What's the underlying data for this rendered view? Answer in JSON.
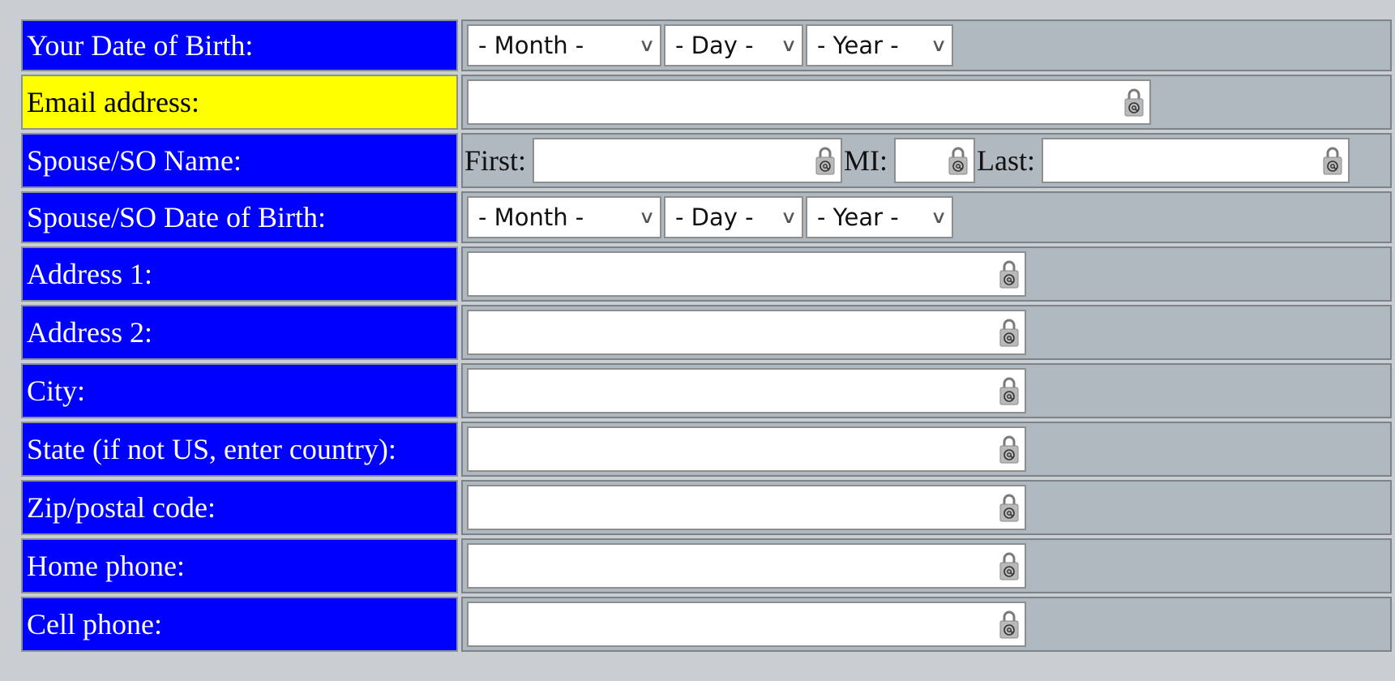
{
  "colors": {
    "label_bg": "#0000ff",
    "label_highlight_bg": "#ffff00",
    "field_bg": "#b0b8c0"
  },
  "fields": {
    "dob": {
      "label": "Your Date of Birth:",
      "month": "- Month -",
      "day": "- Day -",
      "year": "- Year -"
    },
    "email": {
      "label": "Email address:",
      "value": ""
    },
    "spouse_name": {
      "label": "Spouse/SO Name:",
      "first_label": "First:",
      "mi_label": "MI:",
      "last_label": "Last:"
    },
    "spouse_dob": {
      "label": "Spouse/SO Date of Birth:",
      "month": "- Month -",
      "day": "- Day -",
      "year": "- Year -"
    },
    "address1": {
      "label": "Address 1:"
    },
    "address2": {
      "label": "Address 2:"
    },
    "city": {
      "label": "City:"
    },
    "state": {
      "label": "State (if not US, enter country):"
    },
    "zip": {
      "label": "Zip/postal code:"
    },
    "home_phone": {
      "label": "Home phone:"
    },
    "cell_phone": {
      "label": "Cell phone:"
    }
  },
  "icons": {
    "field_icon": "padlock-at-icon",
    "dropdown_icon": "chevron-down-icon"
  }
}
